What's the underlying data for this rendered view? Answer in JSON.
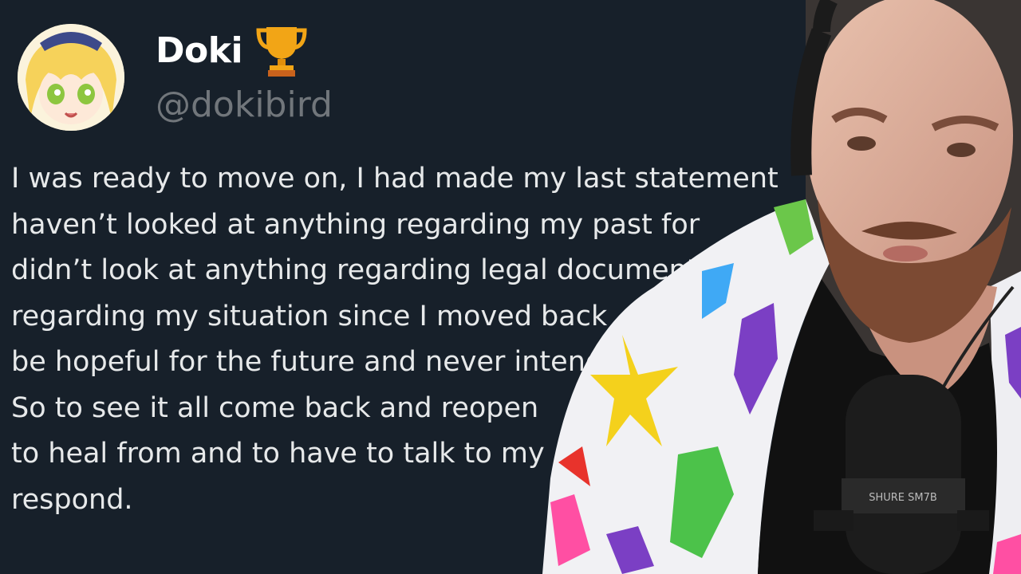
{
  "tweet": {
    "display_name": "Doki",
    "badge_icon": "trophy-icon",
    "handle": "@dokibird",
    "lines": [
      "I was ready to move on, I had made my last statement",
      "haven’t looked at anything regarding my past for",
      "didn’t look at anything regarding legal documents",
      "regarding my situation since I moved back",
      "be hopeful for the future and never intended",
      "So to see it all come back and reopen",
      "to heal from and to have to talk to my",
      "respond."
    ]
  },
  "colors": {
    "background": "#17202a",
    "name": "#ffffff",
    "handle": "#71767b",
    "text": "#e7e9ea"
  },
  "overlay": {
    "subject": "streamer-webcam",
    "microphone_label": "SHURE SM7B"
  }
}
